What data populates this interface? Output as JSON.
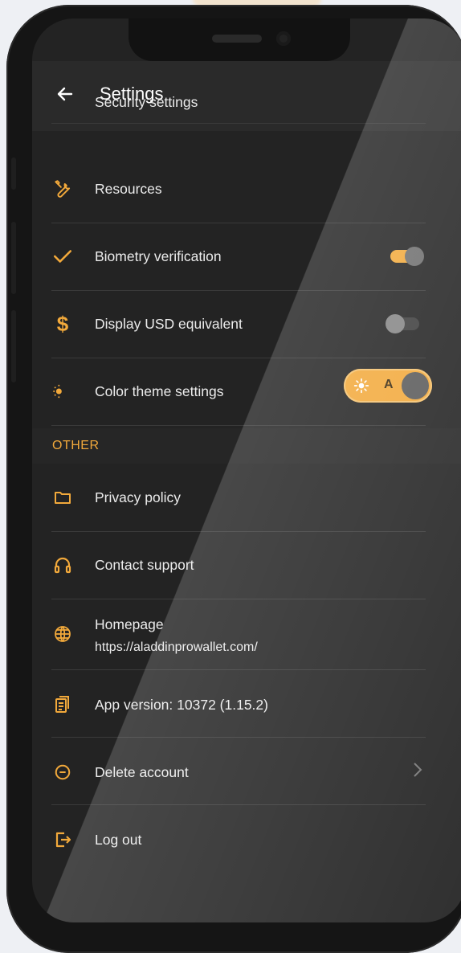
{
  "header": {
    "title": "Settings"
  },
  "settings": {
    "partial_item_label": "Security settings",
    "resources_label": "Resources",
    "biometry_label": "Biometry verification",
    "biometry_enabled": true,
    "usd_label": "Display USD equivalent",
    "usd_enabled": false,
    "theme_label": "Color theme settings",
    "theme_mode_label": "A"
  },
  "other": {
    "section_label": "OTHER",
    "privacy_label": "Privacy policy",
    "support_label": "Contact support",
    "homepage_label": "Homepage",
    "homepage_url": "https://aladdinprowallet.com/",
    "app_version_label": "App version: 10372 (1.15.2)",
    "delete_label": "Delete account",
    "logout_label": "Log out"
  },
  "colors": {
    "accent": "#f2a93b",
    "background": "#232323",
    "text": "#ececec"
  }
}
